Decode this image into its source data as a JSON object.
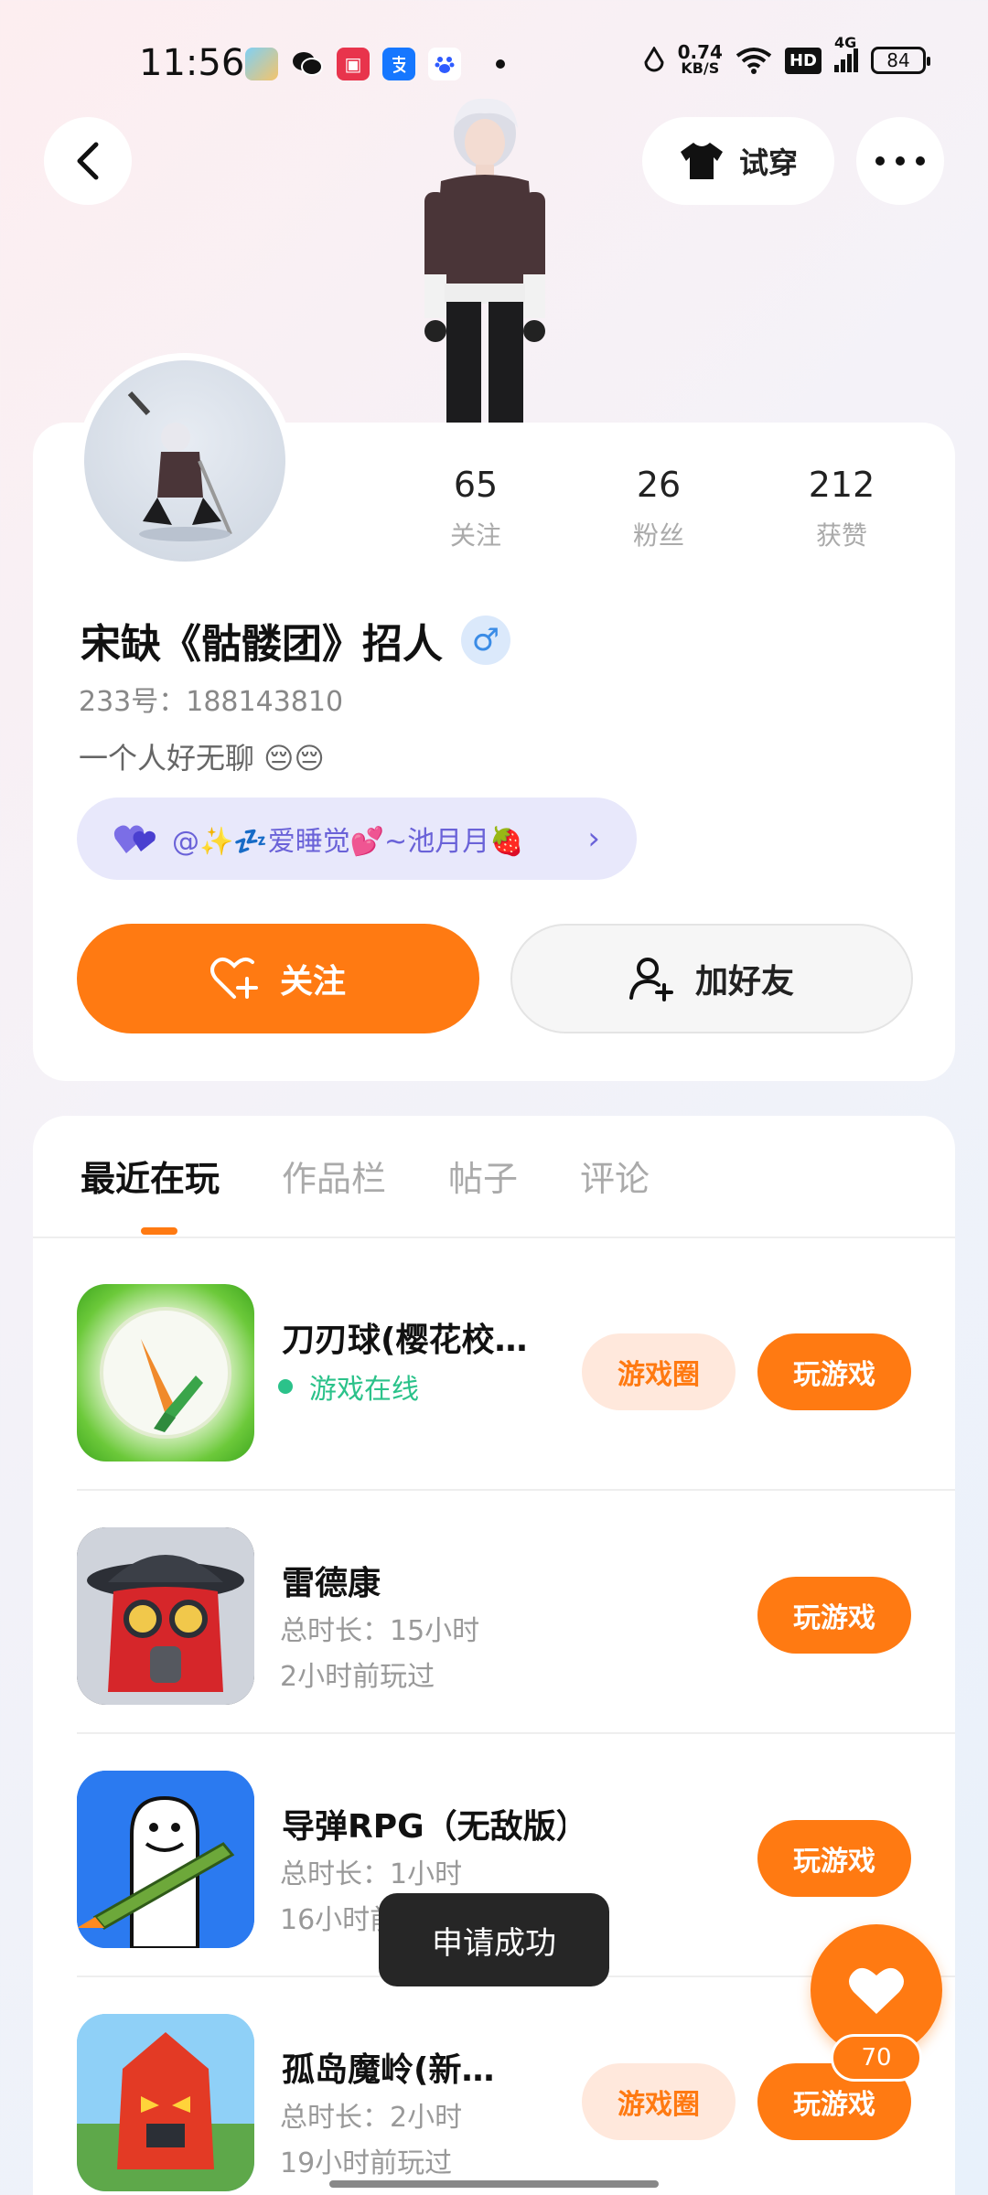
{
  "status_bar": {
    "time": "11:56",
    "net_speed_value": "0.74",
    "net_speed_unit": "KB/S",
    "hd": "HD",
    "network": "4G",
    "battery": "84"
  },
  "header": {
    "tryon_label": "试穿"
  },
  "profile": {
    "stats": [
      {
        "value": "65",
        "label": "关注"
      },
      {
        "value": "26",
        "label": "粉丝"
      },
      {
        "value": "212",
        "label": "获赞"
      }
    ],
    "username": "宋缺《骷髅团》招人",
    "gender_symbol": "♂",
    "uid": "233号：188143810",
    "bio": "一个人好无聊 😔😔",
    "relation": "@✨💤爱睡觉💕~池月月🍓",
    "follow_label": "关注",
    "add_friend_label": "加好友"
  },
  "tabs": [
    {
      "label": "最近在玩",
      "active": true
    },
    {
      "label": "作品栏",
      "active": false
    },
    {
      "label": "帖子",
      "active": false
    },
    {
      "label": "评论",
      "active": false
    }
  ],
  "games": [
    {
      "title": "刀刃球(樱花校…",
      "status": "游戏在线",
      "circle_label": "游戏圈",
      "play_label": "玩游戏"
    },
    {
      "title": "雷德康",
      "duration": "总时长：15小时",
      "last_played": "2小时前玩过",
      "play_label": "玩游戏"
    },
    {
      "title": "导弹RPG（无敌版）",
      "duration": "总时长：1小时",
      "last_played": "16小时前玩过",
      "play_label": "玩游戏"
    },
    {
      "title": "孤岛魔岭(新…",
      "duration": "总时长：2小时",
      "last_played": "19小时前玩过",
      "circle_label": "游戏圈",
      "play_label": "玩游戏"
    }
  ],
  "toast": "申请成功",
  "like_count": "70",
  "colors": {
    "accent": "#ff7a12",
    "online": "#2bc28a",
    "relation": "#6a62d8"
  }
}
